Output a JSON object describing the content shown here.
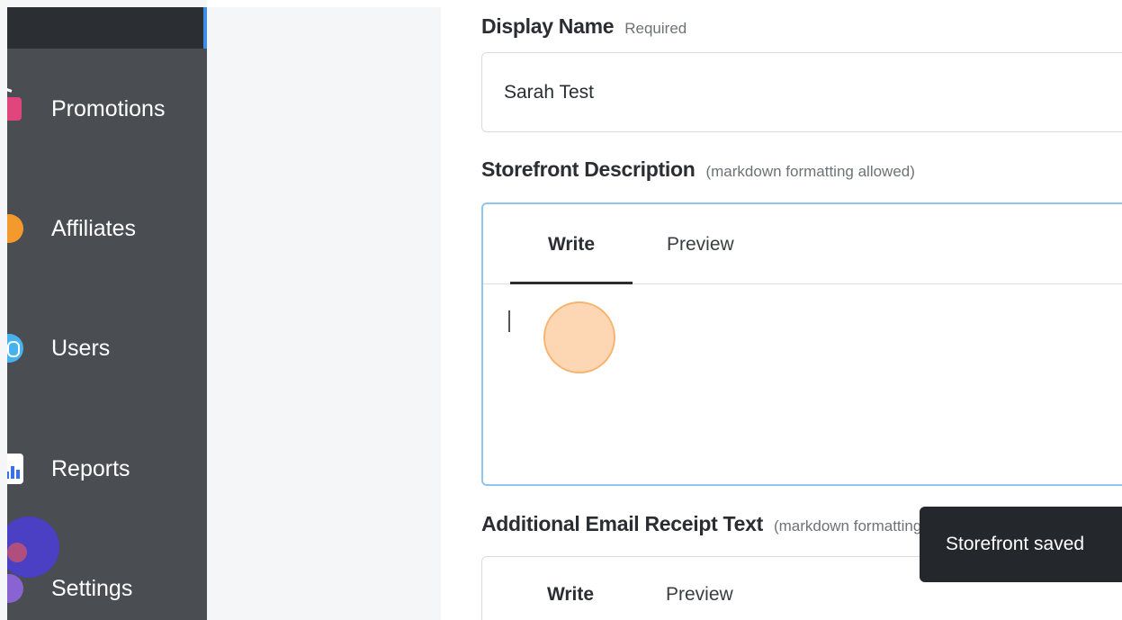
{
  "sidebar": {
    "items": [
      {
        "label": "Promotions",
        "icon": "shopping-basket-icon"
      },
      {
        "label": "Affiliates",
        "icon": "affiliates-icon"
      },
      {
        "label": "Users",
        "icon": "fingerprint-icon"
      },
      {
        "label": "Reports",
        "icon": "bar-chart-icon"
      },
      {
        "label": "Settings",
        "icon": "settings-icon"
      }
    ],
    "active_color": "#3d8fe6",
    "background": "#4a4e53"
  },
  "form": {
    "display_name": {
      "label": "Display Name",
      "hint": "Required",
      "value": "Sarah Test"
    },
    "storefront_description": {
      "label": "Storefront Description",
      "hint": "(markdown formatting allowed)",
      "tabs": {
        "write": "Write",
        "preview": "Preview"
      },
      "value": ""
    },
    "email_receipt": {
      "label": "Additional Email Receipt Text",
      "hint": "(markdown formatting allowed)",
      "tabs": {
        "write": "Write",
        "preview": "Preview"
      }
    }
  },
  "toast": {
    "message": "Storefront saved"
  }
}
